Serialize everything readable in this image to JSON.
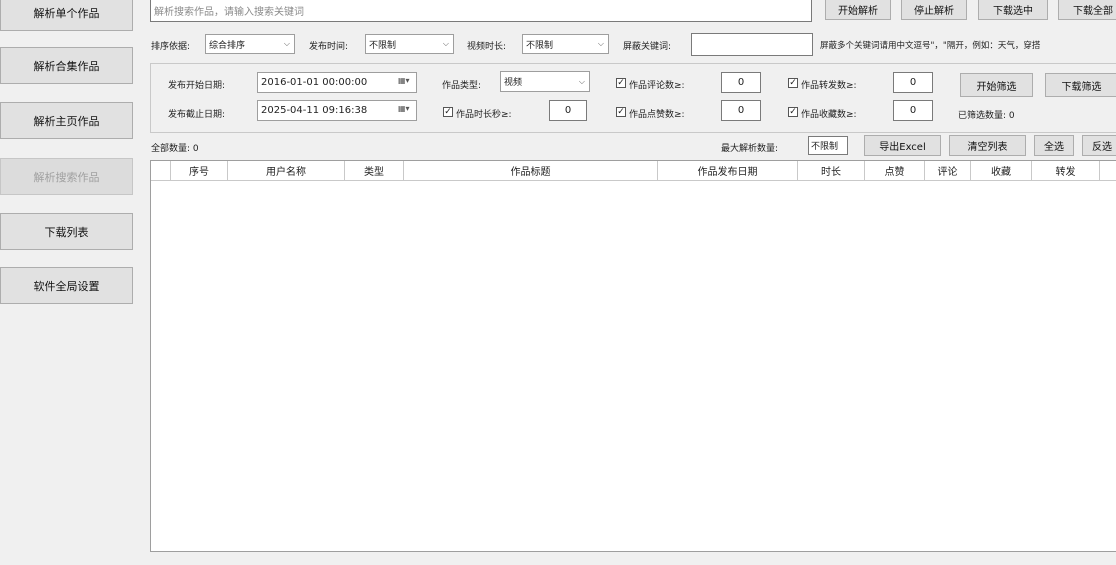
{
  "sidebar": {
    "items": [
      {
        "label": "解析单个作品",
        "disabled": false
      },
      {
        "label": "解析合集作品",
        "disabled": false
      },
      {
        "label": "解析主页作品",
        "disabled": false
      },
      {
        "label": "解析搜索作品",
        "disabled": true
      },
      {
        "label": "下载列表",
        "disabled": false
      },
      {
        "label": "软件全局设置",
        "disabled": false
      }
    ]
  },
  "search": {
    "placeholder": "解析搜索作品，请输入搜索关键词",
    "start_label": "开始解析",
    "stop_label": "停止解析",
    "download_selected_label": "下载选中",
    "download_all_label": "下载全部"
  },
  "options": {
    "sort_label": "排序依据:",
    "sort_value": "综合排序",
    "publish_time_label": "发布时间:",
    "publish_time_value": "不限制",
    "video_duration_label": "视频时长:",
    "video_duration_value": "不限制",
    "block_keyword_label": "屏蔽关键词:",
    "block_keyword_value": "",
    "block_hint": "屏蔽多个关键词请用中文逗号\"，\"隔开，例如：天气，穿搭"
  },
  "filter": {
    "start_date_label": "发布开始日期:",
    "start_date_value": "2016-01-01 00:00:00",
    "end_date_label": "发布截止日期:",
    "end_date_value": "2025-04-11 09:16:38",
    "type_label": "作品类型:",
    "type_value": "视频",
    "duration_label": "作品时长秒≥:",
    "duration_value": "0",
    "comment_label": "作品评论数≥:",
    "comment_value": "0",
    "like_label": "作品点赞数≥:",
    "like_value": "0",
    "forward_label": "作品转发数≥:",
    "forward_value": "0",
    "collect_label": "作品收藏数≥:",
    "collect_value": "0",
    "start_filter_label": "开始筛选",
    "download_filter_label": "下载筛选",
    "filtered_count_label": "已筛选数量: 0"
  },
  "toolbar": {
    "total_label": "全部数量: 0",
    "max_parse_label": "最大解析数量:",
    "max_parse_value": "不限制",
    "export_label": "导出Excel",
    "clear_label": "清空列表",
    "select_all_label": "全选",
    "invert_label": "反选"
  },
  "table": {
    "columns": [
      "序号",
      "用户名称",
      "类型",
      "作品标题",
      "作品发布日期",
      "时长",
      "点赞",
      "评论",
      "收藏",
      "转发"
    ]
  }
}
